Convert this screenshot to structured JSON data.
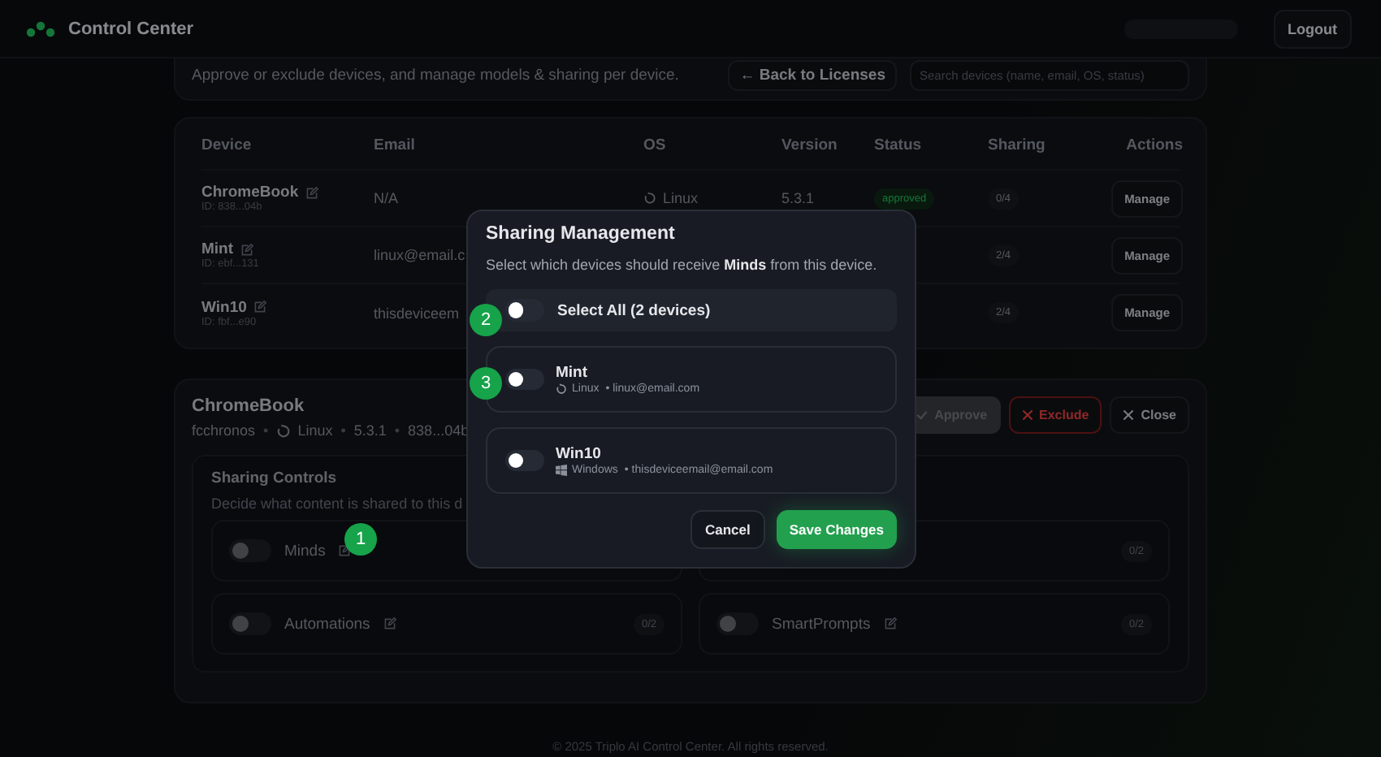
{
  "header": {
    "title": "Control Center",
    "logout": "Logout"
  },
  "top_card": {
    "subtitle": "Approve or exclude devices, and manage models & sharing per device.",
    "back": "← Back to Licenses",
    "search": {
      "placeholder": "Search devices (name, email, OS, status)"
    }
  },
  "table": {
    "columns": [
      "Device",
      "Email",
      "OS",
      "Version",
      "Status",
      "Sharing",
      "Actions"
    ],
    "rows": [
      {
        "name": "ChromeBook",
        "id": "ID: 838...04b",
        "email": "N/A",
        "os": "Linux",
        "version": "5.3.1",
        "status": "approved",
        "sharing": "0/4",
        "action": "Manage"
      },
      {
        "name": "Mint",
        "id": "ID: ebf...131",
        "email": "linux@email.c",
        "sharing": "2/4",
        "action": "Manage"
      },
      {
        "name": "Win10",
        "id": "ID: fbf...e90",
        "email": "thisdeviceem",
        "sharing": "2/4",
        "action": "Manage"
      }
    ]
  },
  "detail": {
    "title": "ChromeBook",
    "meta_separator": "•",
    "meta": [
      "fcchronos",
      "Linux",
      "5.3.1",
      "838...04b"
    ],
    "buttons": [
      {
        "label": "Approve",
        "kind": "approve",
        "disabled": true
      },
      {
        "label": "Exclude",
        "kind": "exclude",
        "disabled": false
      },
      {
        "label": "Close",
        "kind": "close",
        "disabled": false
      }
    ],
    "sharing": {
      "title": "Sharing Controls",
      "description": "Decide what content is shared to this d",
      "items": [
        {
          "name": "Minds",
          "on": false
        },
        {
          "count": "0/2"
        },
        {
          "name": "Automations",
          "count": "0/2",
          "on": false
        },
        {
          "name": "SmartPrompts",
          "count": "0/2",
          "on": false
        }
      ]
    }
  },
  "modal": {
    "title": "Sharing Management",
    "description": "Select which devices should receive **Minds** from this device.",
    "select_all": {
      "label": "Select All (2 devices)",
      "on": false
    },
    "devices": [
      {
        "name": "Mint",
        "os": "Linux",
        "email": "• linux@email.com",
        "on": false
      },
      {
        "name": "Win10",
        "os": "Windows",
        "email": "• thisdeviceemail@email.com",
        "on": false
      }
    ],
    "cancel": "Cancel",
    "save": "Save Changes"
  },
  "markers": [
    {
      "label": "1"
    },
    {
      "label": "2"
    },
    {
      "label": "3"
    }
  ],
  "footer": "© 2025 Triplo AI Control Center. All rights reserved."
}
